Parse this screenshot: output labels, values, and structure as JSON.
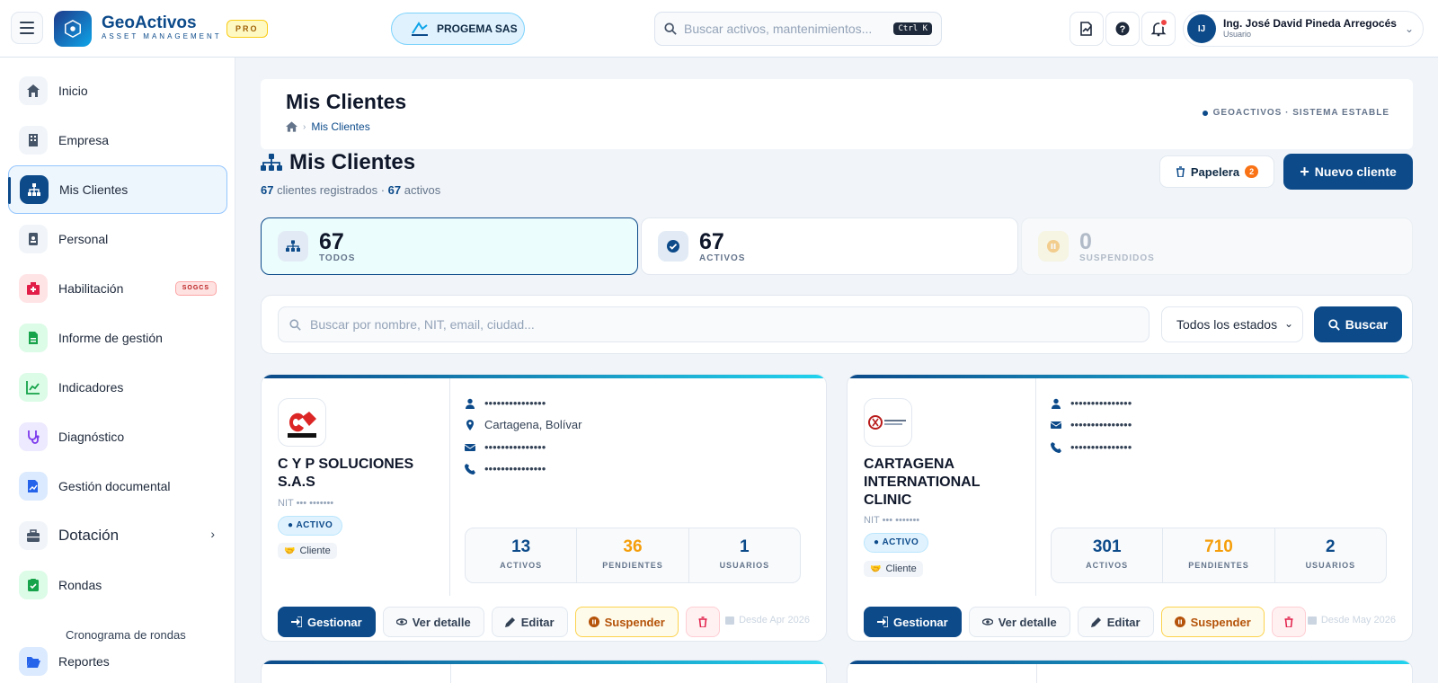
{
  "topbar": {
    "brand_name": "GeoActivos",
    "brand_sub": "ASSET MANAGEMENT",
    "plan_badge": "PRO",
    "company": "PROGEMA SAS",
    "search_placeholder": "Buscar activos, mantenimientos...",
    "search_shortcut": "Ctrl K",
    "user_name": "Ing. José David Pineda Arregocés",
    "user_role": "Usuario",
    "user_initials": "IJ"
  },
  "sidebar": {
    "items": [
      {
        "label": "Inicio",
        "icon": "home-icon",
        "color": "#475569"
      },
      {
        "label": "Empresa",
        "icon": "building-icon",
        "color": "#475569"
      },
      {
        "label": "Mis Clientes",
        "icon": "sitemap-icon",
        "color": "#0c4a8a"
      },
      {
        "label": "Personal",
        "icon": "id-badge-icon",
        "color": "#475569"
      },
      {
        "label": "Habilitación",
        "icon": "hospital-icon",
        "color": "#e11d48",
        "badge": "SOGCS"
      },
      {
        "label": "Informe de gestión",
        "icon": "file-report-icon",
        "color": "#16a34a"
      },
      {
        "label": "Indicadores",
        "icon": "chart-line-icon",
        "color": "#16a34a"
      },
      {
        "label": "Diagnóstico",
        "icon": "stethoscope-icon",
        "color": "#7c3aed"
      },
      {
        "label": "Gestión documental",
        "icon": "file-signature-icon",
        "color": "#2563eb"
      },
      {
        "label": "Dotación",
        "icon": "toolbox-icon",
        "color": "#475569"
      },
      {
        "label": "Rondas",
        "icon": "clipboard-check-icon",
        "color": "#16a34a"
      },
      {
        "label": "Reportes",
        "icon": "folder-open-icon",
        "color": "#2563eb"
      }
    ],
    "sub_item": "Cronograma de rondas"
  },
  "page": {
    "title": "Mis Clientes",
    "breadcrumb": "Mis Clientes",
    "system_status": "GEOACTIVOS · SISTEMA ESTABLE",
    "section_title": "Mis Clientes",
    "registered_count": "67",
    "registered_text": "clientes registrados",
    "active_count": "67",
    "active_text": "activos",
    "trash_label": "Papelera",
    "trash_count": "2",
    "new_label": "Nuevo cliente"
  },
  "stats": [
    {
      "value": "67",
      "label": "TODOS"
    },
    {
      "value": "67",
      "label": "ACTIVOS"
    },
    {
      "value": "0",
      "label": "SUSPENDIDOS"
    }
  ],
  "filter": {
    "placeholder": "Buscar por nombre, NIT, email, ciudad...",
    "status_selected": "Todos los estados",
    "search_button": "Buscar"
  },
  "cards": [
    {
      "name_line1": "C Y P SOLUCIONES",
      "name_line2": "S.A.S",
      "nit": "NIT ••• •••••••",
      "status": "ACTIVO",
      "type": "Cliente",
      "contact": "•••••••••••••••",
      "city": "Cartagena, Bolívar",
      "email": "•••••••••••••••",
      "phone": "•••••••••••••••",
      "assets": "13",
      "pending": "36",
      "users": "1",
      "since": "Desde Apr 2026"
    },
    {
      "name_line1": "CARTAGENA",
      "name_line2": "INTERNATIONAL",
      "name_line3": "CLINIC",
      "nit": "NIT ••• •••••••",
      "status": "ACTIVO",
      "type": "Cliente",
      "contact": "•••••••••••••••",
      "email": "•••••••••••••••",
      "phone": "•••••••••••••••",
      "assets": "301",
      "pending": "710",
      "users": "2",
      "since": "Desde May 2026"
    }
  ],
  "labels": {
    "metric_assets": "ACTIVOS",
    "metric_pending": "PENDIENTES",
    "metric_users": "USUARIOS",
    "btn_manage": "Gestionar",
    "btn_detail": "Ver detalle",
    "btn_edit": "Editar",
    "btn_suspend": "Suspender"
  }
}
